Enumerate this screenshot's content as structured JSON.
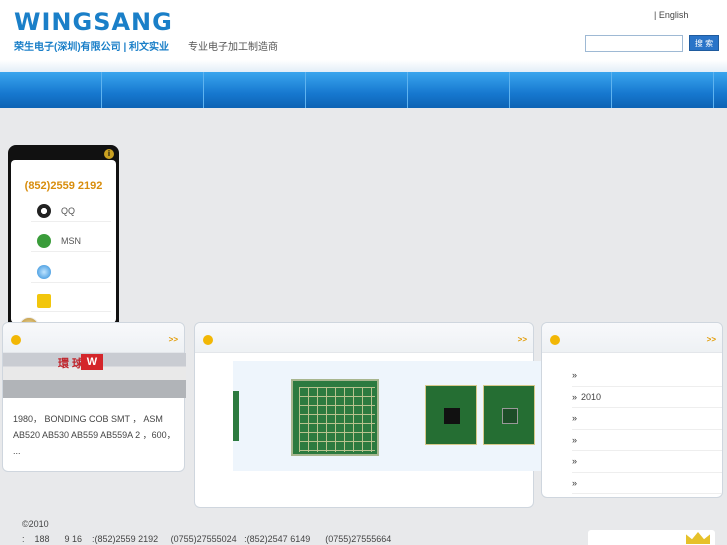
{
  "header": {
    "logo": "WINGSANG",
    "subtitle_cn": "荣生电子(深圳)有限公司 | 利文实业",
    "slogan": "专业电子加工制造商",
    "lang_link": "| English",
    "search_placeholder": "",
    "search_button": "搜 索"
  },
  "nav": {
    "items": [
      "",
      "",
      "",
      "",
      "",
      "",
      "",
      ""
    ]
  },
  "contact_widget": {
    "phone": "(852)2559 2192",
    "rows": [
      {
        "icon": "qq-icon",
        "label": "QQ"
      },
      {
        "icon": "msn-icon",
        "label": "MSN"
      },
      {
        "icon": "globe-icon",
        "label": ""
      },
      {
        "icon": "chat-icon",
        "label": ""
      }
    ]
  },
  "boxes": {
    "about": {
      "more": ">>",
      "sign": "環  球",
      "sign_logo": "W",
      "intro": "1980，  BONDING  COB SMT ，  ASM AB520 AB530 AB559 AB559A 2 ，600，      ..."
    },
    "products": {
      "more": ">>"
    },
    "news": {
      "more": ">>",
      "items": [
        "",
        "2010",
        "",
        "",
        "",
        ""
      ]
    }
  },
  "footer": {
    "copyright": "©2010",
    "contact_line": ":    188      9 16    :(852)2559 2192     (0755)27555024   :(852)2547 6149      (0755)27555664"
  }
}
